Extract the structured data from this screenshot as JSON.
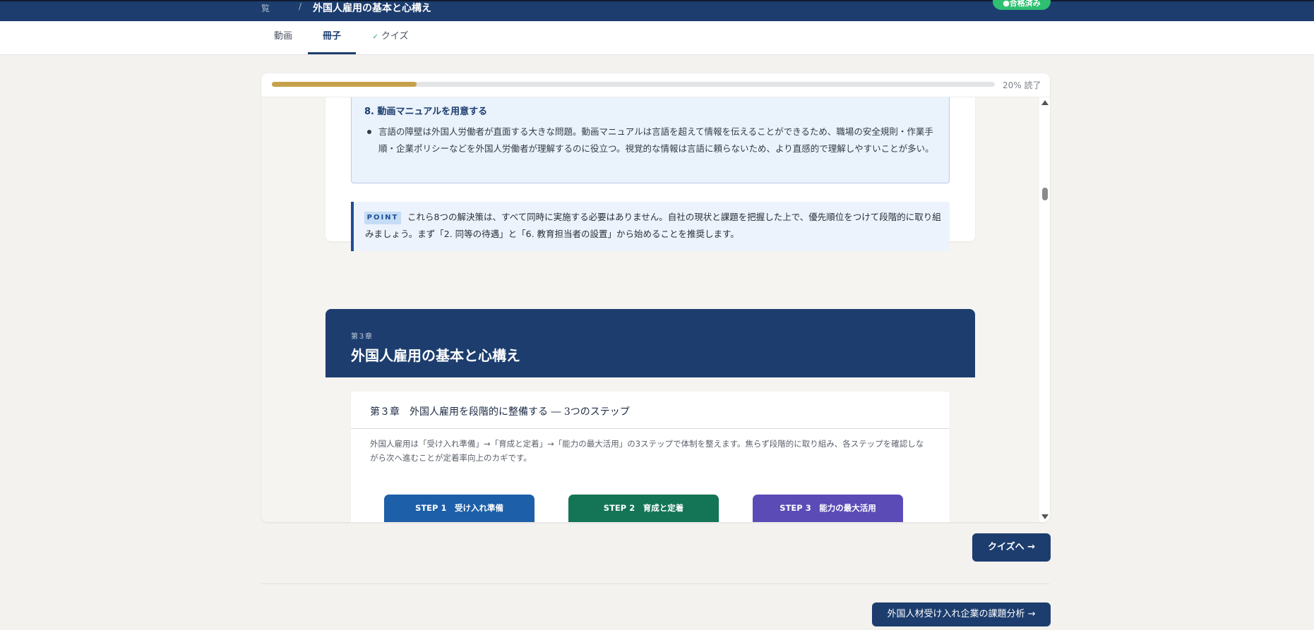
{
  "header": {
    "breadcrumb_tail": "覧",
    "breadcrumb_sep": "/",
    "title": "外国人雇用の基本と心構え",
    "badge": "●合格済み"
  },
  "tabs": [
    {
      "label": "動画",
      "active": false
    },
    {
      "label": "冊子",
      "active": true
    },
    {
      "label": "クイズ",
      "active": false,
      "check": "✓"
    }
  ],
  "progress": {
    "fraction": 0.2,
    "label": "20% 読了"
  },
  "solution": {
    "title": "8. 動画マニュアルを用意する",
    "text": "言語の障壁は外国人労働者が直面する大きな問題。動画マニュアルは言語を超えて情報を伝えることができるため、職場の安全規則・作業手順・企業ポリシーなどを外国人労働者が理解するのに役立つ。視覚的な情報は言語に頼らないため、より直感的で理解しやすいことが多い。"
  },
  "point": {
    "badge": "POINT",
    "text": "これら8つの解決策は、すべて同時に実施する必要はありません。自社の現状と課題を把握した上で、優先順位をつけて段階的に取り組みましょう。まず「2. 同等の待遇」と「6. 教育担当者の設置」から始めることを推奨します。"
  },
  "chapter3": {
    "small": "第３章",
    "title": "外国人雇用の基本と心構え",
    "section_title": "第３章　外国人雇用を段階的に整備する ― 3つのステップ",
    "section_desc": "外国人雇用は「受け入れ準備」→「育成と定着」→「能力の最大活用」の3ステップで体制を整えます。焦らず段階的に取り組み、各ステップを確認しながら次へ進むことが定着率向上のカギです。",
    "steps": [
      {
        "label": "STEP 1　受け入れ準備",
        "color": "#1d5fa8"
      },
      {
        "label": "STEP 2　育成と定着",
        "color": "#137556"
      },
      {
        "label": "STEP 3　能力の最大活用",
        "color": "#5a4bb7"
      }
    ]
  },
  "buttons": {
    "quiz": "クイズへ →",
    "next": "外国人材受け入れ企業の課題分析 →"
  }
}
